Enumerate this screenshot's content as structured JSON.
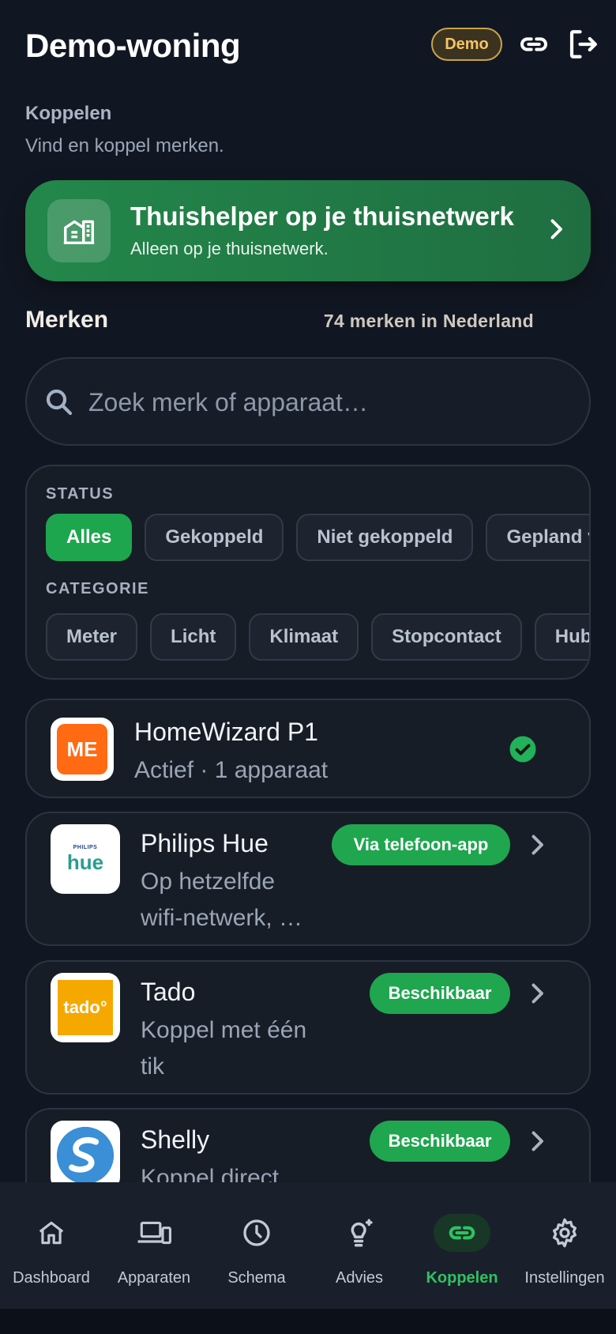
{
  "header": {
    "title": "Demo-woning",
    "badge": "Demo"
  },
  "intro": {
    "label": "Koppelen",
    "subtitle": "Vind en koppel merken."
  },
  "banner": {
    "title": "Thuishelper op je thuisnetwerk",
    "subtitle": "Alleen op je thuisnetwerk."
  },
  "brands": {
    "title": "Merken",
    "count": "74 merken in Nederland"
  },
  "search": {
    "placeholder": "Zoek merk of apparaat…",
    "value": ""
  },
  "filters": {
    "status_label": "STATUS",
    "status": [
      "Alles",
      "Gekoppeld",
      "Niet gekoppeld",
      "Gepland voor later"
    ],
    "category_label": "CATEGORIE",
    "category": [
      "Meter",
      "Licht",
      "Klimaat",
      "Stopcontact",
      "Hub-apparaten"
    ]
  },
  "cards": [
    {
      "name": "HomeWizard P1",
      "desc": "Actief · 1 apparaat",
      "logo_text": "ME"
    },
    {
      "name": "Philips Hue",
      "desc_line1": "Op hetzelfde",
      "desc_line2": "wifi-netwerk, …",
      "badge": "Via telefoon-app",
      "logo_top": "PHILIPS",
      "logo_text": "hue"
    },
    {
      "name": "Tado",
      "desc_line1": "Koppel met één",
      "desc_line2": "tik",
      "badge": "Beschikbaar",
      "logo_text": "tado°"
    },
    {
      "name": "Shelly",
      "desc_line1": "Koppel direct",
      "badge": "Beschikbaar"
    }
  ],
  "nav": [
    {
      "label": "Dashboard",
      "icon": "home-icon"
    },
    {
      "label": "Apparaten",
      "icon": "devices-icon"
    },
    {
      "label": "Schema",
      "icon": "clock-icon"
    },
    {
      "label": "Advies",
      "icon": "lightbulb-icon"
    },
    {
      "label": "Koppelen",
      "icon": "link-icon",
      "active": true
    },
    {
      "label": "Instellingen",
      "icon": "gear-icon"
    }
  ],
  "colors": {
    "accent": "#1ea64e",
    "background": "#111722",
    "badge_gold": "#f4c465"
  }
}
